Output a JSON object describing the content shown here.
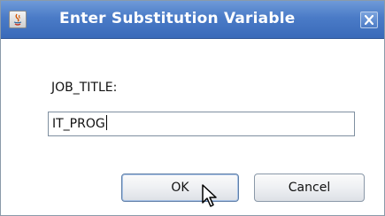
{
  "dialog": {
    "title": "Enter Substitution Variable",
    "app_icon": "java-app-icon",
    "close_icon": "close-icon"
  },
  "form": {
    "label": "JOB_TITLE:",
    "value": "IT_PROG"
  },
  "buttons": {
    "ok_label": "OK",
    "cancel_label": "Cancel"
  },
  "colors": {
    "titlebar": "#4a7bc7",
    "title_text": "#ffffff",
    "background": "#ffffff"
  }
}
